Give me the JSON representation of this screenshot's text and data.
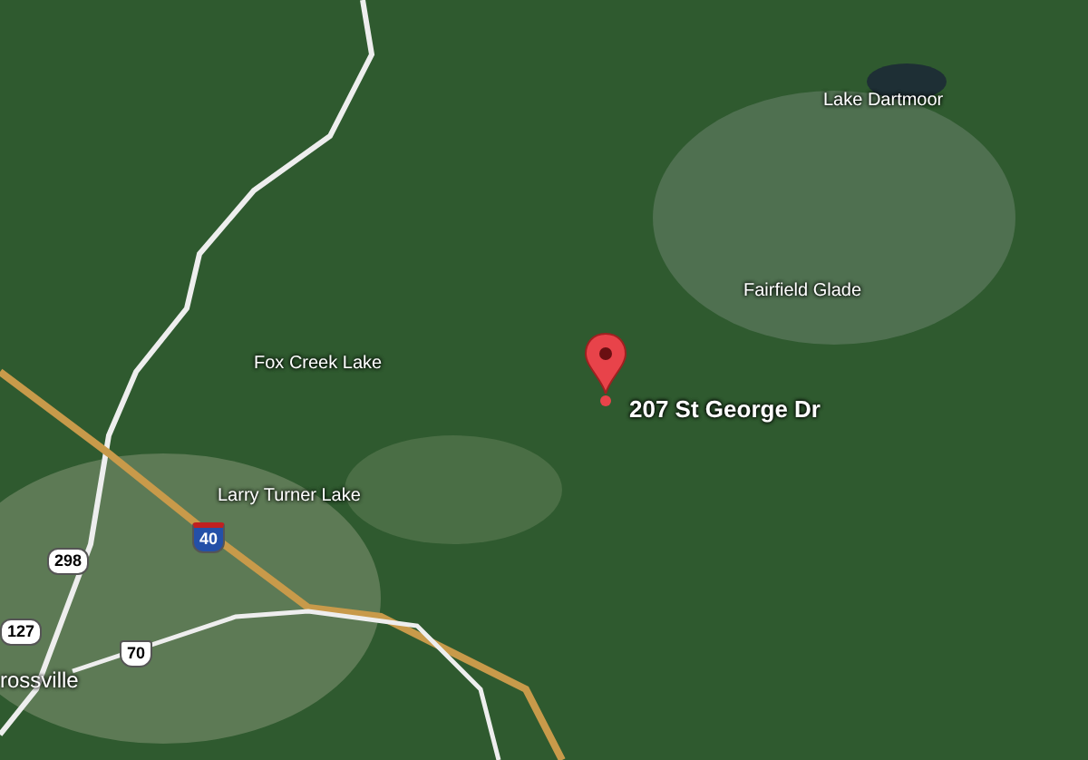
{
  "map": {
    "place_labels": [
      {
        "label": "Lake Dartmoor"
      },
      {
        "label": "Fairfield Glade"
      },
      {
        "label": "Fox Creek Lake"
      },
      {
        "label": "Larry Turner Lake"
      },
      {
        "label": "rossville"
      }
    ],
    "marker": {
      "label": "207 St George Dr"
    },
    "shields": [
      {
        "label": "40",
        "kind": "interstate"
      },
      {
        "label": "298",
        "kind": "state"
      },
      {
        "label": "127",
        "kind": "state"
      },
      {
        "label": "70",
        "kind": "us"
      }
    ]
  }
}
